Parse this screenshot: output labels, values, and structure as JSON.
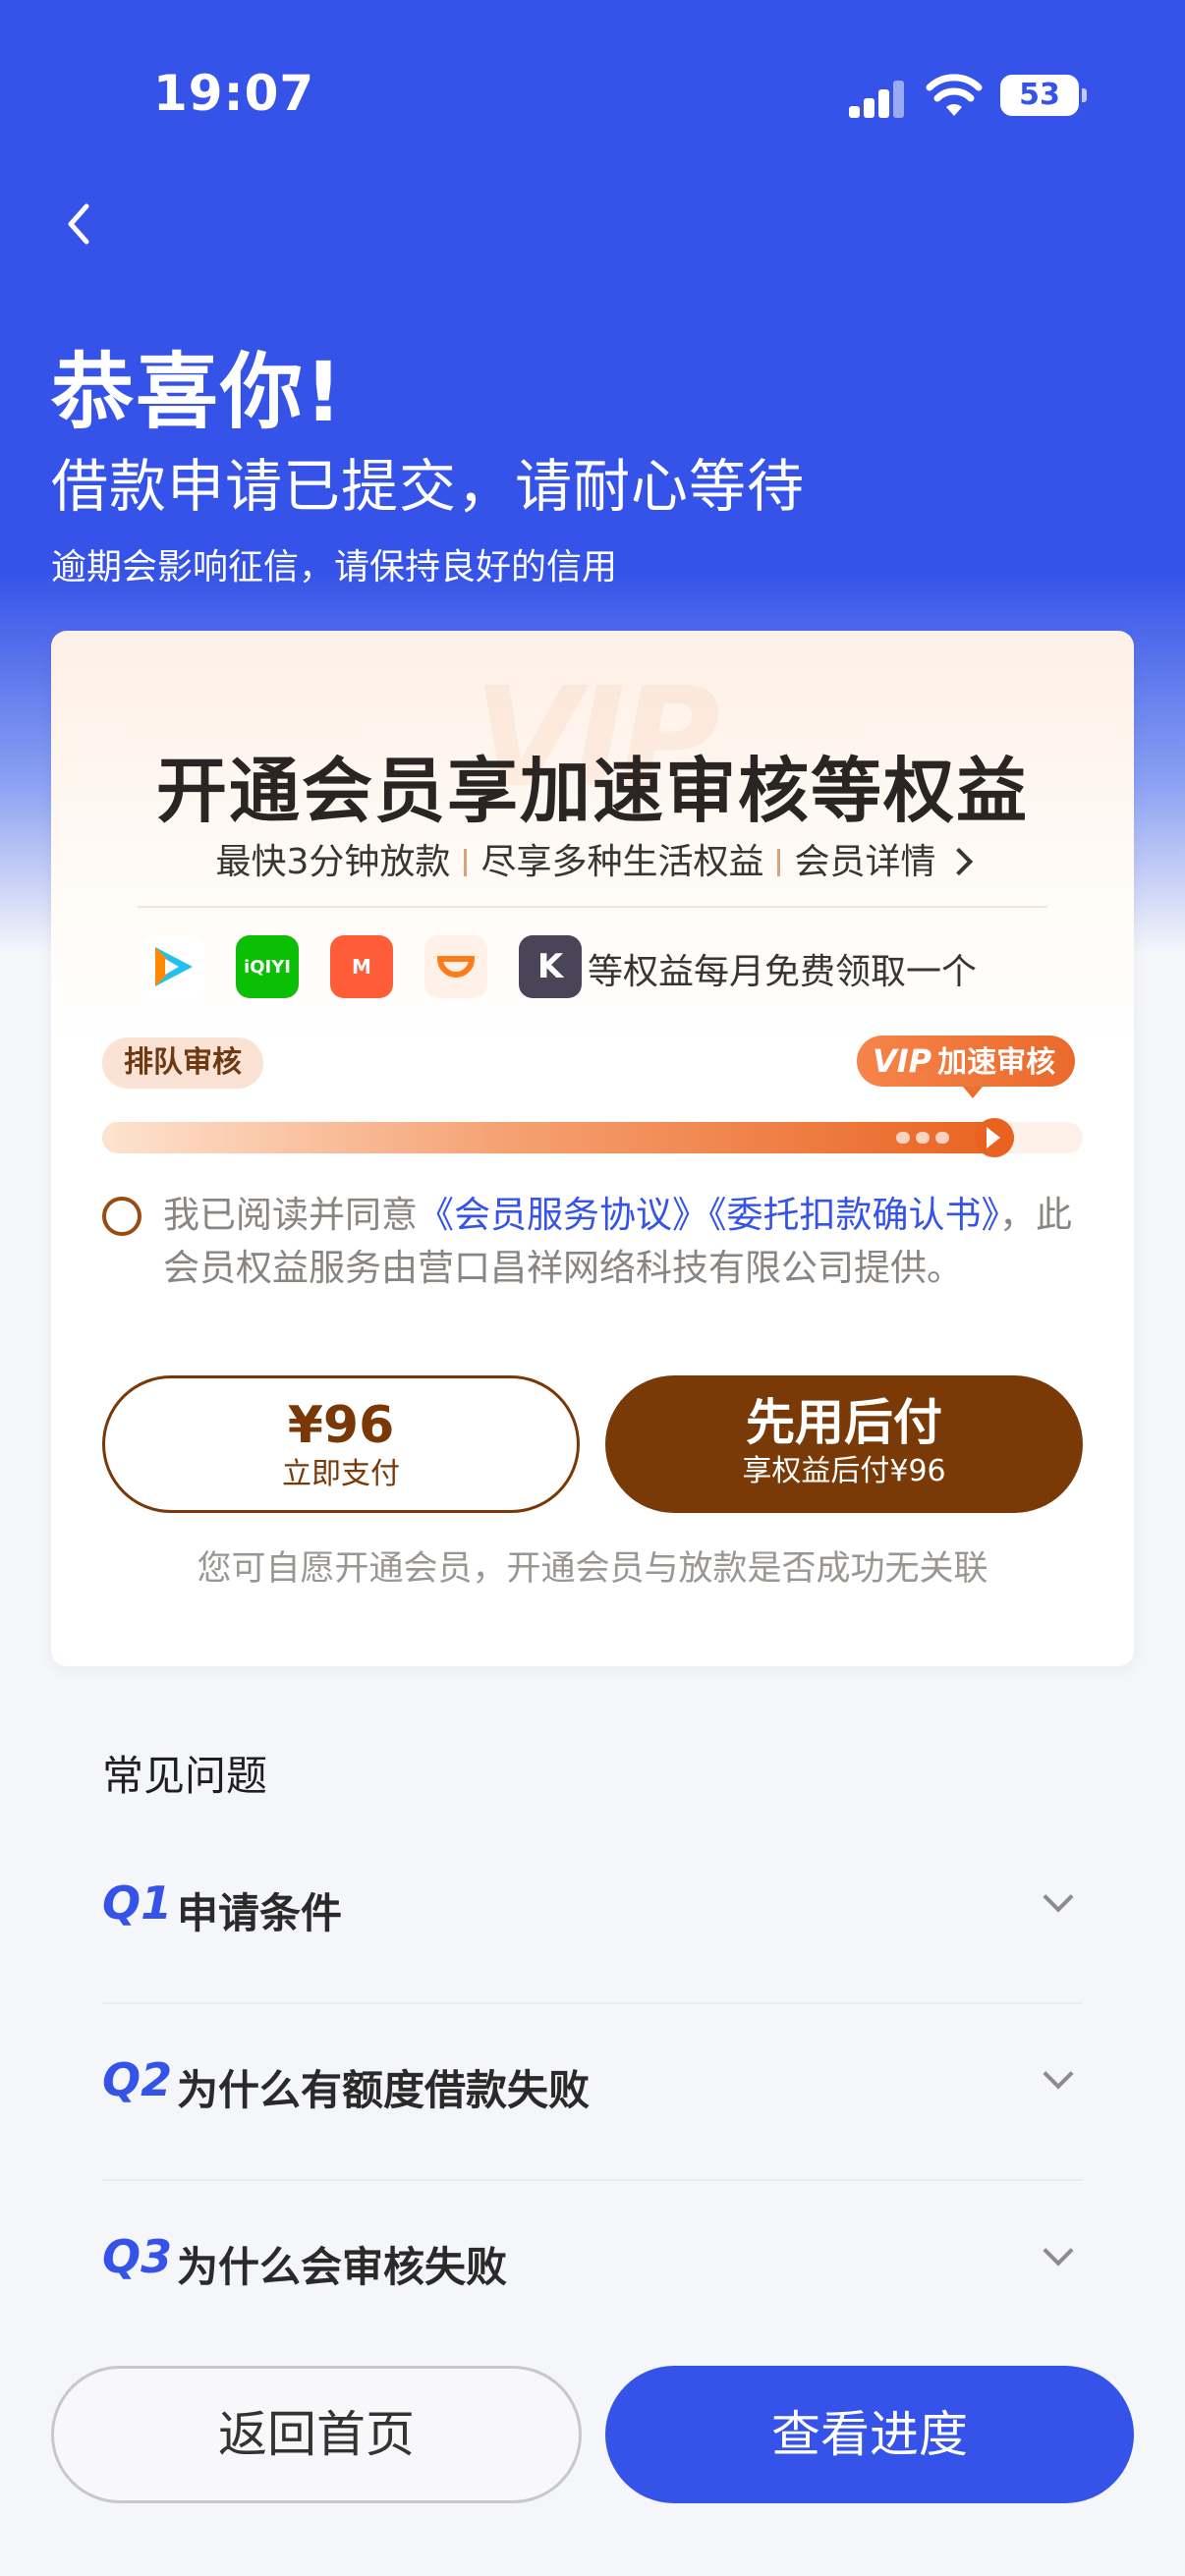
{
  "status_bar": {
    "time": "19:07",
    "battery": "53"
  },
  "header": {
    "title": "恭喜你!",
    "subtitle": "借款申请已提交，请耐心等待",
    "tip": "逾期会影响征信，请保持良好的信用"
  },
  "vip_card": {
    "watermark": "VIP",
    "title": "开通会员享加速审核等权益",
    "features": [
      "最快3分钟放款",
      "尽享多种生活权益",
      "会员详情"
    ],
    "app_icons": [
      "tencent-video-icon",
      "iqiyi-icon",
      "mango-tv-icon",
      "didi-icon",
      "keep-icon"
    ],
    "app_icon_labels": {
      "iqiyi": "iQIYI",
      "mango": "M",
      "didi": "D",
      "keep": "K"
    },
    "rights_text": "等权益每月免费领取一个",
    "queue_label": "排队审核",
    "fast_label_vip": "VIP",
    "fast_label": "加速审核",
    "progress": 0.93,
    "agreement_prefix": "我已阅读并同意",
    "agreement_link1": "《会员服务协议》",
    "agreement_link2": "《委托扣款确认书》",
    "agreement_suffix": "，此会员权益服务由营口昌祥网络科技有限公司提供。",
    "pay_now_price": "¥96",
    "pay_now_label": "立即支付",
    "pay_later_label": "先用后付",
    "pay_later_sub": "享权益后付¥96",
    "note": "您可自愿开通会员，开通会员与放款是否成功无关联"
  },
  "faq": {
    "title": "常见问题",
    "items": [
      {
        "q": "Q1",
        "text": "申请条件"
      },
      {
        "q": "Q2",
        "text": "为什么有额度借款失败"
      },
      {
        "q": "Q3",
        "text": "为什么会审核失败"
      }
    ]
  },
  "bottom": {
    "home_label": "返回首页",
    "progress_label": "查看进度"
  },
  "colors": {
    "brand_blue": "#3553e8",
    "vip_brown": "#7a3a08",
    "vip_orange": "#e9621f"
  }
}
